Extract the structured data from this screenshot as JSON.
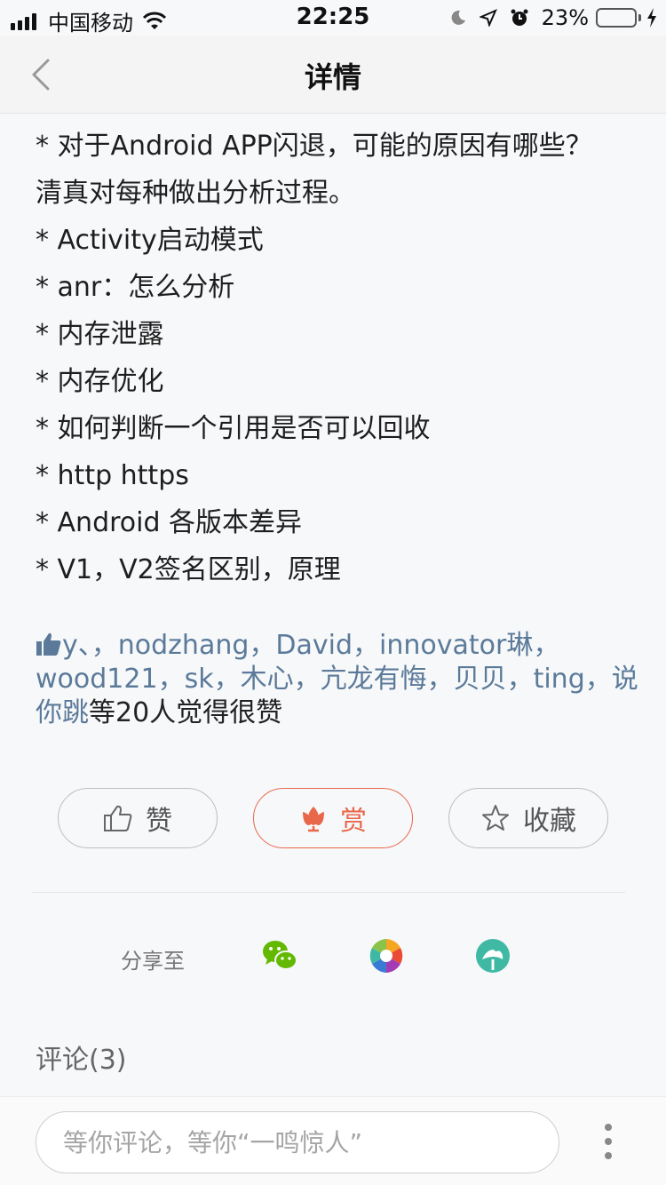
{
  "status_bar": {
    "carrier": "中国移动",
    "time": "22:25",
    "battery_percent": "23%",
    "battery_level": 0.23
  },
  "nav": {
    "title": "详情"
  },
  "article": {
    "lines": [
      "* 对于Android APP闪退，可能的原因有哪些？",
      "清真对每种做出分析过程。",
      "* Activity启动模式",
      "* anr：怎么分析",
      "* 内存泄露",
      "* 内存优化",
      "* 如何判断一个引用是否可以回收",
      "* http https",
      "* Android 各版本差异",
      "* V1，V2签名区别，原理"
    ]
  },
  "likes": {
    "users": [
      "y、",
      "nodzhang",
      "David",
      "innovator琳",
      "wood121",
      "sk",
      "木心",
      "亢龙有悔",
      "贝贝",
      "ting",
      "说你跳"
    ],
    "separator": "，",
    "suffix": "等20人觉得很赞"
  },
  "actions": {
    "like_label": "赞",
    "reward_label": "赏",
    "favorite_label": "收藏"
  },
  "share": {
    "label": "分享至",
    "targets": [
      "wechat-icon",
      "moments-icon",
      "share-other-icon"
    ]
  },
  "comments": {
    "title": "评论(3)"
  },
  "bottom_bar": {
    "input_placeholder": "等你评论，等你“一鸣惊人”"
  },
  "colors": {
    "link": "#5b7a99",
    "accent": "#e8674a",
    "wechat": "#62b900",
    "other_share": "#3fb9a3"
  }
}
